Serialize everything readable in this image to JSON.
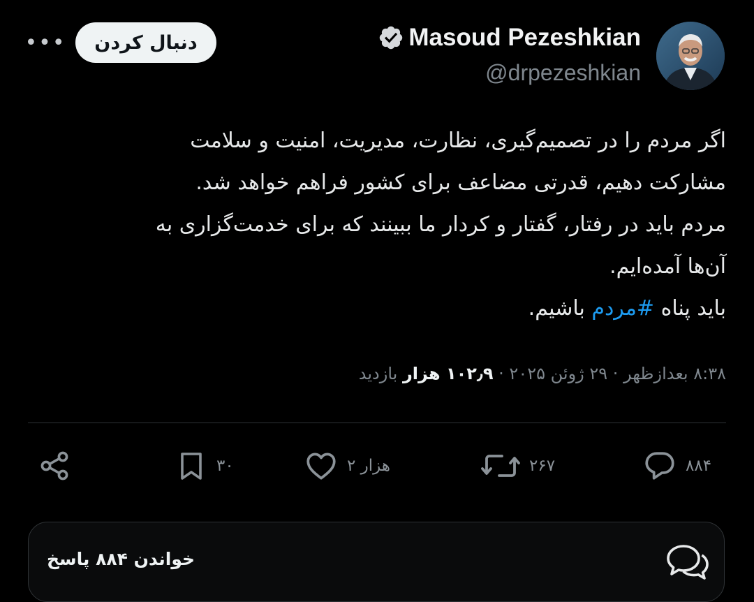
{
  "header": {
    "more_label": "•••",
    "follow_label": "دنبال کردن",
    "display_name": "Masoud Pezeshkian",
    "handle": "@drpezeshkian"
  },
  "tweet": {
    "lines": [
      "اگر مردم را در تصمیم‌گیری، نظارت، مدیریت، امنیت و سلامت",
      "مشارکت دهیم، قدرتی مضاعف برای کشور فراهم خواهد شد.",
      "مردم باید در رفتار، گفتار و کردار ما ببینند که برای خدمت‌گزاری به",
      "آن‌ها آمده‌ایم."
    ],
    "last_line_before": "باید پناه ",
    "hashtag": "#مردم",
    "last_line_after": " باشیم."
  },
  "meta": {
    "time": "۸:۳۸ بعدازظهر",
    "date": "۲۹ ژوئن ۲۰۲۵",
    "separator": "·",
    "views_count": "۱۰۲٫۹ هزار",
    "views_label": "بازدید"
  },
  "actions": {
    "replies": "۸۸۴",
    "reposts": "۲۶۷",
    "likes": "۲ هزار",
    "bookmarks": "۳۰"
  },
  "read_replies": {
    "label": "خواندن ۸۸۴ پاسخ"
  },
  "colors": {
    "background": "#000000",
    "text": "#e7e9ea",
    "muted": "#7f878e",
    "accent": "#1d9bf0",
    "follow_button_bg": "#eff3f4"
  },
  "icons": {
    "more": "more-icon",
    "verified": "verified-badge-icon",
    "share": "share-icon",
    "bookmark": "bookmark-icon",
    "like": "heart-icon",
    "repost": "repost-icon",
    "reply": "reply-icon",
    "replies_bar": "chat-bubbles-icon"
  }
}
